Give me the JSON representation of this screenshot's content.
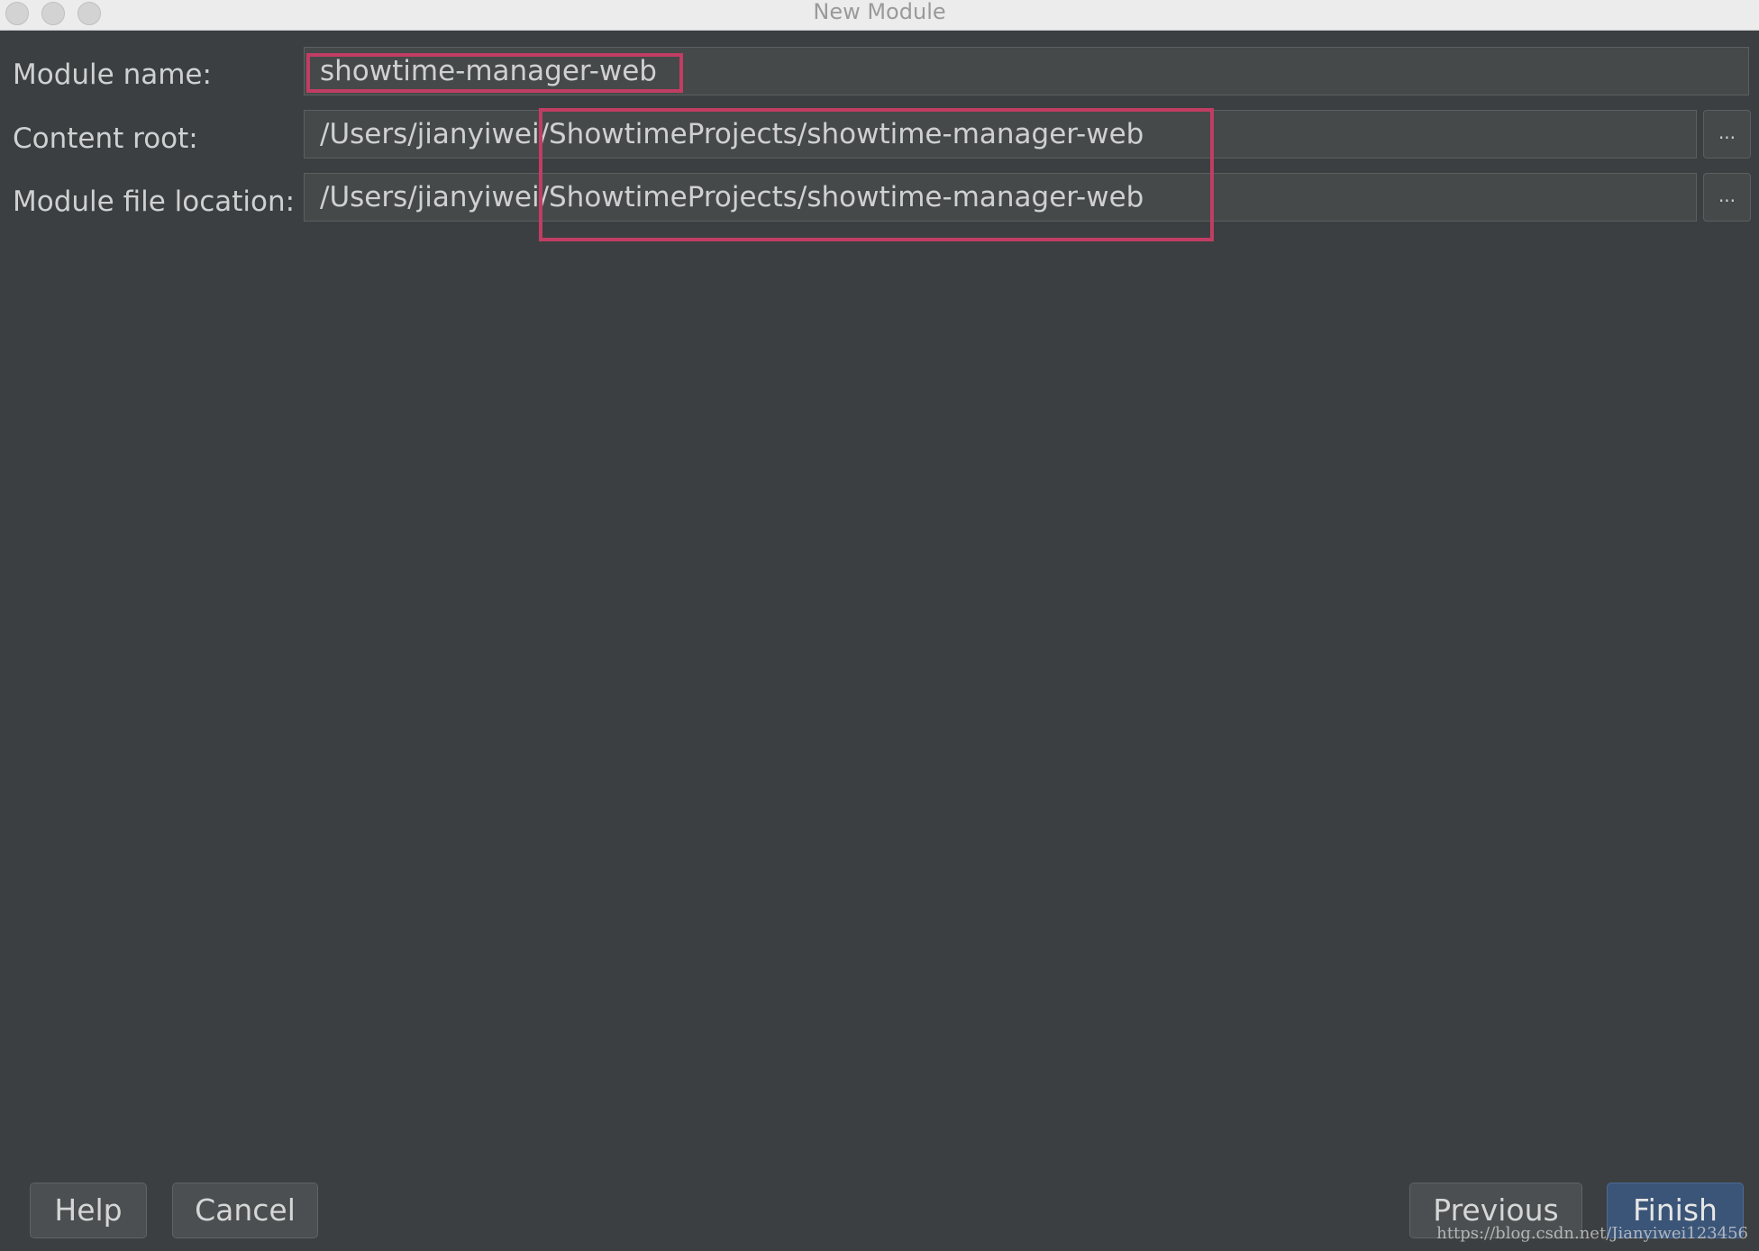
{
  "window": {
    "title": "New Module"
  },
  "form": {
    "module_name_label": "Module name:",
    "module_name_value": "showtime-manager-web",
    "content_root_label": "Content root:",
    "content_root_value": "/Users/jianyiwei/ShowtimeProjects/showtime-manager-web",
    "module_file_location_label": "Module file location:",
    "module_file_location_value": "/Users/jianyiwei/ShowtimeProjects/showtime-manager-web",
    "browse_label": "..."
  },
  "footer": {
    "help_label": "Help",
    "cancel_label": "Cancel",
    "previous_label": "Previous",
    "finish_label": "Finish"
  },
  "watermark": "https://blog.csdn.net/Jianyiwei123456",
  "colors": {
    "background": "#3c3f41",
    "highlight": "#c13d63",
    "primary_button": "#3b5578"
  }
}
